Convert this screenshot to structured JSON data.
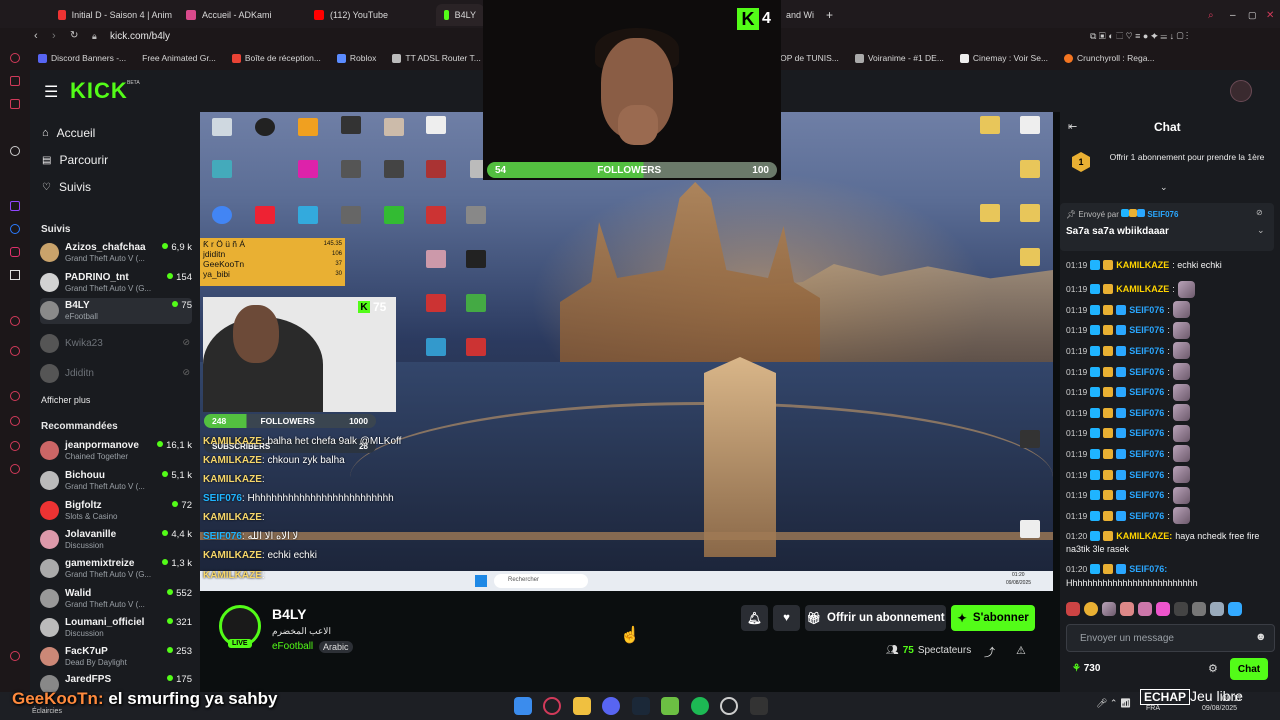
{
  "browser": {
    "tabs": [
      {
        "label": "Initial D - Saison 4 | Anim",
        "color": "#e33"
      },
      {
        "label": "Accueil - ADKami",
        "color": "#d94a8c"
      },
      {
        "label": "(112) YouTube",
        "color": "#ff0000"
      },
      {
        "label": "B4LY",
        "color": "#53fc18"
      },
      {
        "label": "and Wi",
        "color": "#888"
      }
    ],
    "url": "kick.com/b4ly",
    "bookmarks": [
      {
        "label": "Discord Banners -...",
        "color": "#5865f2"
      },
      {
        "label": "Free Animated Gr...",
        "color": "#777"
      },
      {
        "label": "Boîte de réception...",
        "color": "#ea4335"
      },
      {
        "label": "Roblox",
        "color": "#5b8cff"
      },
      {
        "label": "TT ADSL Router T...",
        "color": "#bbb"
      },
      {
        "label": "E-SHOP de TUNIS...",
        "color": "#999"
      },
      {
        "label": "Voiranime - #1 DE...",
        "color": "#aaa"
      },
      {
        "label": "Cinemay : Voir Se...",
        "color": "#eee"
      },
      {
        "label": "Crunchyroll : Rega...",
        "color": "#f47521"
      }
    ]
  },
  "kick": {
    "logo": "KICK",
    "logo_sup": "BETA",
    "nav": [
      {
        "label": "Accueil",
        "icon": "home-icon"
      },
      {
        "label": "Parcourir",
        "icon": "browse-icon"
      },
      {
        "label": "Suivis",
        "icon": "heart-icon"
      }
    ],
    "following_title": "Suivis",
    "following": [
      {
        "name": "Azizos_chafchaa",
        "game": "Grand Theft Auto V (...",
        "viewers": "6,9 k",
        "color": "#c9a36b"
      },
      {
        "name": "PADRINO_tnt",
        "game": "Grand Theft Auto V (G...",
        "viewers": "154",
        "color": "#d2d2d2"
      },
      {
        "name": "B4LY",
        "game": "eFootball",
        "viewers": "75",
        "color": "#8a8a8a"
      },
      {
        "name": "Kwika23",
        "game": "",
        "viewers": "",
        "color": "#555"
      },
      {
        "name": "Jdiditn",
        "game": "",
        "viewers": "",
        "color": "#555"
      }
    ],
    "show_more": "Afficher plus",
    "recommended_title": "Recommandées",
    "recommended": [
      {
        "name": "jeanpormanove",
        "game": "Chained Together",
        "viewers": "16,1 k",
        "color": "#c66"
      },
      {
        "name": "Bichouu",
        "game": "Grand Theft Auto V (...",
        "viewers": "5,1 k",
        "color": "#bbb"
      },
      {
        "name": "Bigfoltz",
        "game": "Slots & Casino",
        "viewers": "72",
        "color": "#e33"
      },
      {
        "name": "Jolavanille",
        "game": "Discussion",
        "viewers": "4,4 k",
        "color": "#d9a"
      },
      {
        "name": "gamemixtreize",
        "game": "Grand Theft Auto V (G...",
        "viewers": "1,3 k",
        "color": "#aaa"
      },
      {
        "name": "Walid",
        "game": "Grand Theft Auto V (...",
        "viewers": "552",
        "color": "#999"
      },
      {
        "name": "Loumani_officiel",
        "game": "Discussion",
        "viewers": "321",
        "color": "#bbb"
      },
      {
        "name": "FacK7uP",
        "game": "Dead By Daylight",
        "viewers": "253",
        "color": "#c87"
      },
      {
        "name": "JaredFPS",
        "game": "",
        "viewers": "175",
        "color": "#888"
      }
    ]
  },
  "stream": {
    "top_cam_followers": {
      "current": "54",
      "label": "FOLLOWERS",
      "goal": "100",
      "progress": 0.54
    },
    "kick_count": "4",
    "viewer_cam_count": "75",
    "donors": [
      {
        "name": "Ƙ r Ö ü ñ Á",
        "value": "145.35"
      },
      {
        "name": "jdiditn",
        "value": "106"
      },
      {
        "name": "GeeKooTn",
        "value": "37"
      },
      {
        "name": "ya_bibi",
        "value": "30"
      }
    ],
    "small_followers": {
      "current": "248",
      "label": "FOLLOWERS",
      "goal": "1000",
      "progress": 0.248
    },
    "subscribers": {
      "label": "SUBSCRIBERS",
      "count": "28"
    },
    "overlay_chat": [
      {
        "user": "KAMILKAZE",
        "text": ": balha het chefa 9alk @MLKoff",
        "user_class": "u"
      },
      {
        "user": "KAMILKAZE",
        "text": ": chkoun zyk balha",
        "user_class": "u"
      },
      {
        "user": "KAMILKAZE",
        "text": ":",
        "user_class": "u"
      },
      {
        "user": "SEIF076",
        "text": ": Hhhhhhhhhhhhhhhhhhhhhhhhhh",
        "user_class": "u2"
      },
      {
        "user": "KAMILKAZE",
        "text": ":",
        "user_class": "u"
      },
      {
        "user": "SEIF076",
        "text": ": لا الاه الا الله",
        "user_class": "u2"
      },
      {
        "user": "KAMILKAZE",
        "text": ": echki echki",
        "user_class": "u"
      },
      {
        "user": "KAMILKAZE",
        "text": ":",
        "user_class": "u"
      }
    ],
    "taskbar_search": "Rechercher",
    "taskbar_time": "01:20",
    "taskbar_date": "09/08/2025"
  },
  "channel": {
    "name": "B4LY",
    "subtitle": "الاعب المخضرم",
    "game": "eFootball",
    "language": "Arabic",
    "live": "LIVE",
    "viewers": "75",
    "viewers_label": "Spectateurs",
    "gift_label": "Offrir un abonnement",
    "subscribe_label": "S'abonner"
  },
  "chat": {
    "title": "Chat",
    "gift_prompt": "Offrir 1 abonnement pour prendre la 1ère",
    "gift_rank": "1",
    "pinned_by": "Envoyé par",
    "pinned_user": "SEIF076",
    "pinned_text": "Sa7a sa7a wbiikdaaar",
    "messages": [
      {
        "time": "01:19",
        "user": "KAMILKAZE",
        "text": ": echki echki",
        "kind": "k",
        "emote": false
      },
      {
        "time": "01:19",
        "user": "KAMILKAZE",
        "text": ":",
        "kind": "k",
        "emote": true
      },
      {
        "time": "01:19",
        "user": "SEIF076",
        "text": ":",
        "kind": "s",
        "emote": true
      },
      {
        "time": "01:19",
        "user": "SEIF076",
        "text": ":",
        "kind": "s",
        "emote": true
      },
      {
        "time": "01:19",
        "user": "SEIF076",
        "text": ":",
        "kind": "s",
        "emote": true
      },
      {
        "time": "01:19",
        "user": "SEIF076",
        "text": ":",
        "kind": "s",
        "emote": true
      },
      {
        "time": "01:19",
        "user": "SEIF076",
        "text": ":",
        "kind": "s",
        "emote": true
      },
      {
        "time": "01:19",
        "user": "SEIF076",
        "text": ":",
        "kind": "s",
        "emote": true
      },
      {
        "time": "01:19",
        "user": "SEIF076",
        "text": ":",
        "kind": "s",
        "emote": true
      },
      {
        "time": "01:19",
        "user": "SEIF076",
        "text": ":",
        "kind": "s",
        "emote": true
      },
      {
        "time": "01:19",
        "user": "SEIF076",
        "text": ":",
        "kind": "s",
        "emote": true
      },
      {
        "time": "01:19",
        "user": "SEIF076",
        "text": ":",
        "kind": "s",
        "emote": true
      },
      {
        "time": "01:19",
        "user": "SEIF076",
        "text": ":",
        "kind": "s",
        "emote": true
      }
    ],
    "msg_last1_time": "01:20",
    "msg_last1_user": "KAMILKAZE:",
    "msg_last1_text": "haya nchedk free fire",
    "msg_last1_text2": "na3tik 3le rasek",
    "msg_last2_time": "01:20",
    "msg_last2_user": "SEIF076:",
    "msg_last2_text": "Hhhhhhhhhhhhhhhhhhhhhhhhhh",
    "input_placeholder": "Envoyer un message",
    "points": "730",
    "send_label": "Chat"
  },
  "os": {
    "subtitle_user": "GeeKooTn:",
    "subtitle_text": " el smurfing ya sahby",
    "weather": "Éclaircies",
    "echap": "ECHAP",
    "jeu_libre": "Jeu libre",
    "lang": "FRA",
    "time": "00:17",
    "date": "09/08/2025"
  }
}
